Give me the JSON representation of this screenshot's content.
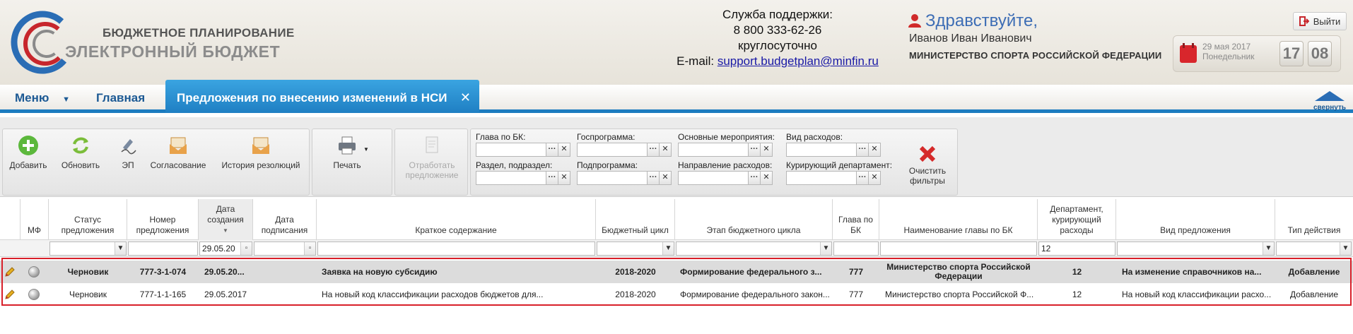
{
  "header": {
    "brand_line1": "БЮДЖЕТНОЕ ПЛАНИРОВАНИЕ",
    "brand_line2": "ЭЛЕКТРОННЫЙ БЮДЖЕТ",
    "support_title": "Служба поддержки:",
    "support_phone": "8 800 333-62-26",
    "support_hours": "круглосуточно",
    "support_email_label": "E-mail:",
    "support_email": "support.budgetplan@minfin.ru",
    "greeting": "Здравствуйте,",
    "user_name": "Иванов Иван Иванович",
    "ministry": "МИНИСТЕРСТВО СПОРТА РОССИЙСКОЙ ФЕДЕРАЦИИ",
    "exit_label": "Выйти",
    "date": "29 мая 2017",
    "weekday": "Понедельник",
    "hour": "17",
    "minute": "08"
  },
  "nav": {
    "menu": "Меню",
    "home": "Главная",
    "active_tab": "Предложения по внесению изменений в НСИ",
    "collapse": "свернуть"
  },
  "toolbar": {
    "add": "Добавить",
    "refresh": "Обновить",
    "ep": "ЭП",
    "approval": "Согласование",
    "history": "История резолюций",
    "print": "Печать",
    "work_line1": "Отработать",
    "work_line2": "предложение",
    "clear_line1": "Очистить",
    "clear_line2": "фильтры",
    "filters": {
      "glava_bk": "Глава по БК:",
      "razdel": "Раздел, подраздел:",
      "gosprogramma": "Госпрограмма:",
      "podprogramma": "Подпрограмма:",
      "osn_meropr": "Основные мероприятия:",
      "napravlenie": "Направление расходов:",
      "vid_rashodov": "Вид расходов:",
      "kur_departament": "Курирующий департамент:"
    }
  },
  "grid": {
    "headers": {
      "mf": "МФ",
      "status": "Статус предложения",
      "number": "Номер предложения",
      "created_line1": "Дата",
      "created_line2": "создания",
      "signed": "Дата подписания",
      "summary": "Краткое содержание",
      "cycle": "Бюджетный цикл",
      "stage": "Этап бюджетного цикла",
      "glava": "Глава по БК",
      "glava_name": "Наименование главы по БК",
      "department": "Департамент, курирующий расходы",
      "kind": "Вид предложения",
      "action": "Тип действия"
    },
    "filters": {
      "created": "29.05.20",
      "department": "12"
    },
    "rows": [
      {
        "status": "Черновик",
        "number": "777-3-1-074",
        "created": "29.05.20...",
        "summary": "Заявка на новую субсидию",
        "cycle": "2018-2020",
        "stage": "Формирование федерального з...",
        "glava": "777",
        "glava_name_line1": "Министерство спорта Российской",
        "glava_name_line2": "Федерации",
        "department": "12",
        "kind": "На изменение справочников на...",
        "action": "Добавление"
      },
      {
        "status": "Черновик",
        "number": "777-1-1-165",
        "created": "29.05.2017",
        "summary": "На новый код классификации расходов бюджетов для...",
        "cycle": "2018-2020",
        "stage": "Формирование федерального закон...",
        "glava": "777",
        "glava_name": "Министерство спорта Российской Ф...",
        "department": "12",
        "kind": "На новый код классификации расхо...",
        "action": "Добавление"
      }
    ]
  }
}
